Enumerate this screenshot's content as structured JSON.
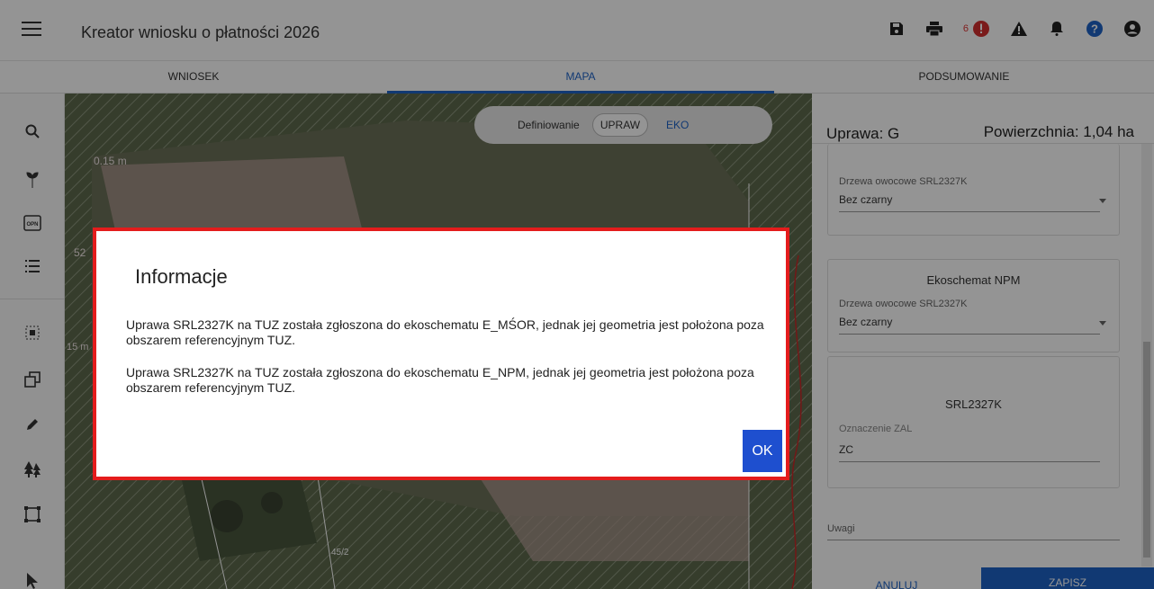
{
  "app": {
    "title": "Kreator wniosku o płatności 2026",
    "notification_count": "6"
  },
  "tabs": [
    {
      "label": "WNIOSEK"
    },
    {
      "label": "MAPA"
    },
    {
      "label": "PODSUMOWANIE"
    }
  ],
  "map": {
    "toggle_label": "Definiowanie",
    "toggle_upraw": "UPRAW",
    "toggle_eko": "EKO",
    "labels": [
      "0.15 m",
      "52",
      "15 m",
      "45/2"
    ]
  },
  "panel": {
    "crop_label": "Uprawa: G",
    "area_label": "Powierzchnia: 1,04 ha",
    "card1": {
      "field_label": "Drzewa owocowe SRL2327K",
      "field_value": "Bez czarny"
    },
    "card2": {
      "title": "Ekoschemat NPM",
      "field_label": "Drzewa owocowe SRL2327K",
      "field_value": "Bez czarny"
    },
    "card3": {
      "title": "SRL2327K",
      "field_label": "Oznaczenie ZAL",
      "field_value": "ZC"
    },
    "notes_label": "Uwagi",
    "cancel": "ANULUJ",
    "save": "ZAPISZ"
  },
  "dialog": {
    "title": "Informacje",
    "message1": "Uprawa SRL2327K na TUZ została zgłoszona do ekoschematu E_MŚOR, jednak jej geometria jest położona poza obszarem referencyjnym TUZ.",
    "message2": "Uprawa SRL2327K na TUZ została zgłoszona do ekoschematu E_NPM, jednak jej geometria jest położona poza obszarem referencyjnym TUZ.",
    "ok": "OK"
  },
  "colors": {
    "accent": "#1e63c7",
    "dialog_border": "#e41c1c",
    "alert": "#d33030"
  }
}
